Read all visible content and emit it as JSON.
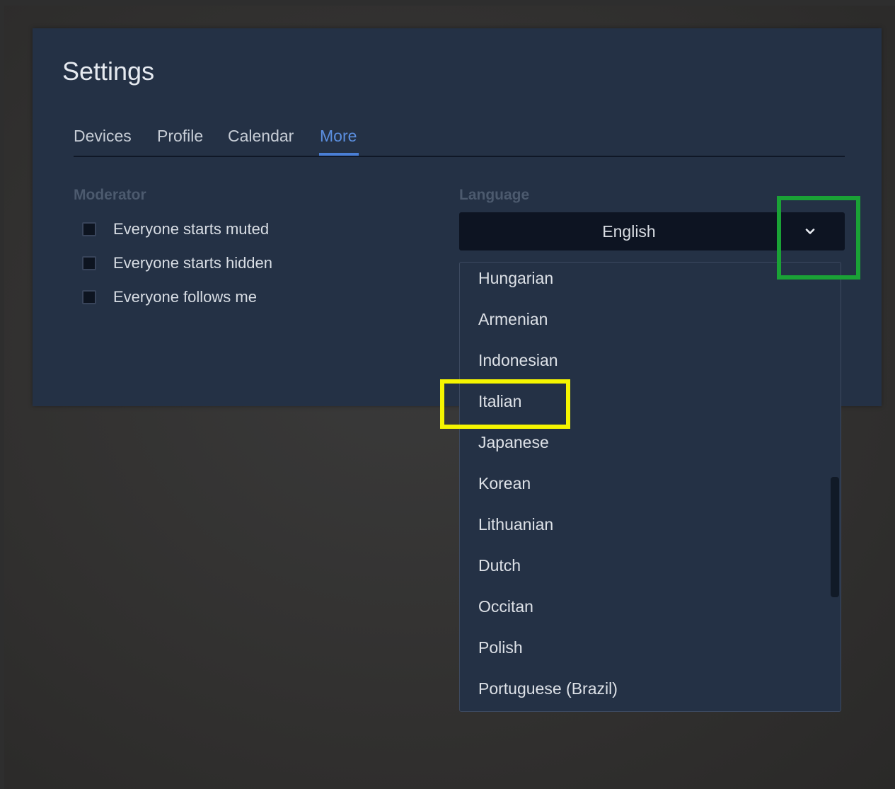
{
  "settings": {
    "title": "Settings",
    "tabs": [
      {
        "label": "Devices"
      },
      {
        "label": "Profile"
      },
      {
        "label": "Calendar"
      },
      {
        "label": "More"
      }
    ],
    "active_tab": "More",
    "moderator": {
      "label": "Moderator",
      "options": [
        {
          "label": "Everyone starts muted",
          "checked": false
        },
        {
          "label": "Everyone starts hidden",
          "checked": false
        },
        {
          "label": "Everyone follows me",
          "checked": false
        }
      ]
    },
    "language": {
      "label": "Language",
      "selected": "English",
      "dropdown_icon": "chevron-down-icon",
      "options": [
        "Hungarian",
        "Armenian",
        "Indonesian",
        "Italian",
        "Japanese",
        "Korean",
        "Lithuanian",
        "Dutch",
        "Occitan",
        "Polish",
        "Portuguese (Brazil)"
      ]
    }
  },
  "colors": {
    "panel": "#243145",
    "accent": "#5b8fe0",
    "select_bg": "#0d1422",
    "highlight_green": "#1aa236",
    "highlight_yellow": "#f5f500"
  }
}
